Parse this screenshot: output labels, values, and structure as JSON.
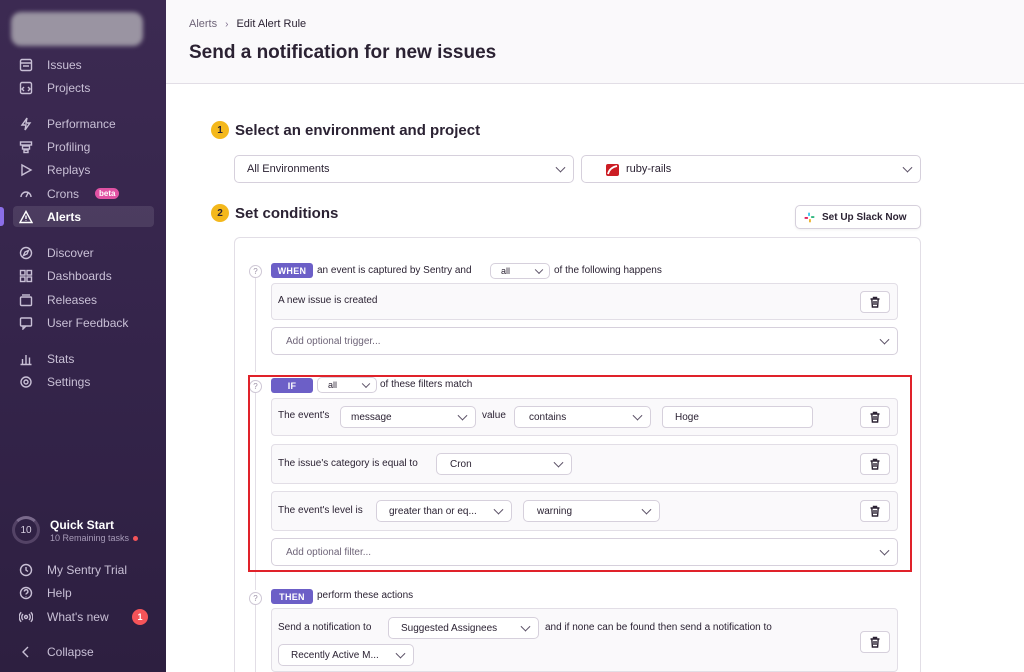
{
  "sidebar": {
    "items": [
      {
        "label": "Issues",
        "icon": "issues-icon"
      },
      {
        "label": "Projects",
        "icon": "projects-icon"
      },
      {
        "label": "Performance",
        "icon": "performance-icon"
      },
      {
        "label": "Profiling",
        "icon": "profiling-icon"
      },
      {
        "label": "Replays",
        "icon": "replays-icon"
      },
      {
        "label": "Crons",
        "icon": "crons-icon",
        "badge": "beta"
      },
      {
        "label": "Alerts",
        "icon": "alerts-icon",
        "active": true
      },
      {
        "label": "Discover",
        "icon": "discover-icon"
      },
      {
        "label": "Dashboards",
        "icon": "dashboards-icon"
      },
      {
        "label": "Releases",
        "icon": "releases-icon"
      },
      {
        "label": "User Feedback",
        "icon": "user-feedback-icon"
      },
      {
        "label": "Stats",
        "icon": "stats-icon"
      },
      {
        "label": "Settings",
        "icon": "settings-icon"
      }
    ],
    "quick_start": {
      "count": "10",
      "title": "Quick Start",
      "subtitle": "10 Remaining tasks"
    },
    "bottom": [
      {
        "label": "My Sentry Trial",
        "icon": "trial-icon"
      },
      {
        "label": "Help",
        "icon": "help-icon"
      },
      {
        "label": "What's new",
        "icon": "broadcast-icon",
        "count": "1"
      },
      {
        "label": "Collapse",
        "icon": "collapse-icon"
      }
    ]
  },
  "header": {
    "breadcrumb": [
      "Alerts",
      "Edit Alert Rule"
    ],
    "title": "Send a notification for new issues"
  },
  "step1": {
    "num": "1",
    "title": "Select an environment and project",
    "environment": "All Environments",
    "project": "ruby-rails"
  },
  "step2": {
    "num": "2",
    "title": "Set conditions",
    "slack_button": "Set Up Slack Now"
  },
  "when": {
    "tag": "WHEN",
    "text_before": "an event is captured by Sentry and",
    "match": "all",
    "text_after": "of the following happens",
    "trigger": "A new issue is created",
    "add_trigger": "Add optional trigger..."
  },
  "if": {
    "tag": "IF",
    "match": "all",
    "text_after": "of these filters match",
    "filter1": {
      "label": "The event's",
      "attribute": "message",
      "value_label": "value",
      "operator": "contains",
      "input": "Hoge"
    },
    "filter2": {
      "label": "The issue's category is equal to",
      "category": "Cron"
    },
    "filter3": {
      "label": "The event's level is",
      "operator": "greater than or eq...",
      "level": "warning"
    },
    "add_filter": "Add optional filter..."
  },
  "then": {
    "tag": "THEN",
    "text_after": "perform these actions",
    "action_label": "Send a notification to",
    "target": "Suggested Assignees",
    "fallback_text": "and if none can be found then send a notification to",
    "fallback": "Recently Active M..."
  },
  "colors": {
    "accent": "#6c5fc7",
    "highlight": "#e0222a",
    "step": "#f4b81c",
    "sidebar": "#3c2a52"
  }
}
